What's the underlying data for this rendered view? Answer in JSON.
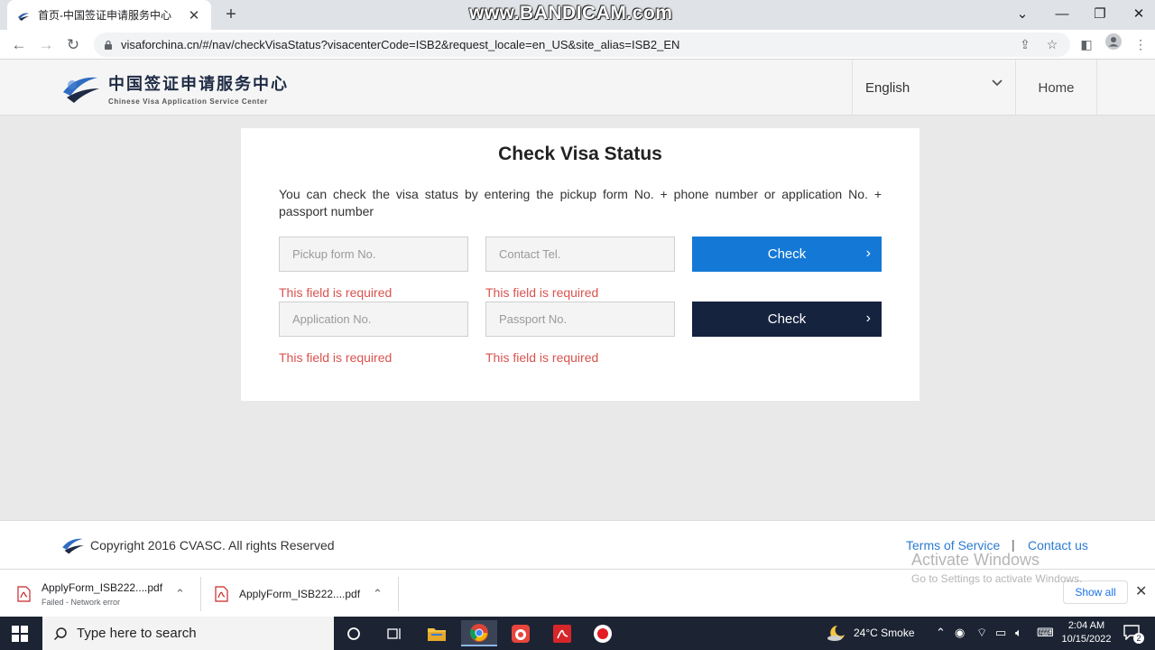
{
  "browser": {
    "tab_title": "首页-中国签证申请服务中心",
    "tab_close": "✕",
    "new_tab": "+",
    "watermark": "www.BANDICAM.com",
    "url": "visaforchina.cn/#/nav/checkVisaStatus?visacenterCode=ISB2&request_locale=en_US&site_alias=ISB2_EN"
  },
  "header": {
    "logo_cn": "中国签证申请服务中心",
    "logo_en": "Chinese Visa Application Service Center",
    "language": "English",
    "home": "Home"
  },
  "main": {
    "title": "Check Visa Status",
    "description": "You can check the visa status by entering the pickup form No. + phone number or application No. + passport number",
    "pickup_placeholder": "Pickup form No.",
    "contact_placeholder": "Contact Tel.",
    "application_placeholder": "Application No.",
    "passport_placeholder": "Passport No.",
    "error": "This field is required",
    "check_label": "Check",
    "arrow": "›"
  },
  "footer": {
    "copyright": "Copyright 2016 CVASC. All rights Reserved",
    "terms": "Terms of Service",
    "separator": "|",
    "contact": "Contact us",
    "activate_title": "Activate Windows",
    "activate_sub": "Go to Settings to activate Windows."
  },
  "downloads": {
    "items": [
      {
        "name": "ApplyForm_ISB222....pdf",
        "status": "Failed - Network error"
      },
      {
        "name": "ApplyForm_ISB222....pdf",
        "status": ""
      }
    ],
    "show_all": "Show all"
  },
  "taskbar": {
    "search_placeholder": "Type here to search",
    "weather": "24°C  Smoke",
    "time": "2:04 AM",
    "date": "10/15/2022",
    "notification_count": "2"
  },
  "colors": {
    "check_primary": "#1479d6",
    "check_secondary": "#15233f",
    "error": "#d9534f",
    "link": "#2b7bd3"
  }
}
